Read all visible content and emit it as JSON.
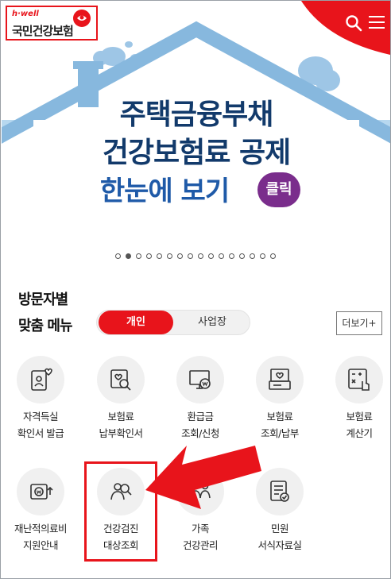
{
  "header": {
    "logo_sub": "h·well",
    "logo_main": "국민건강보험",
    "search_icon": "search-icon",
    "menu_icon": "hamburger-menu-icon"
  },
  "banner": {
    "line1": "주택금융부채",
    "line2": "건강보험료 공제",
    "line3": "한눈에 보기",
    "badge": "클릭",
    "total_slides": 16,
    "active_slide": 2
  },
  "menu": {
    "title_line1": "방문자별",
    "title_line2": "맞춤 메뉴",
    "tab_personal": "개인",
    "tab_business": "사업장",
    "more_button": "더보기+",
    "items": [
      {
        "line1": "자격득실",
        "line2": "확인서 발급",
        "icon": "id-card-heart-icon"
      },
      {
        "line1": "보험료",
        "line2": "납부확인서",
        "icon": "receipt-search-icon"
      },
      {
        "line1": "환급금",
        "line2": "조회/신청",
        "icon": "monitor-refund-icon"
      },
      {
        "line1": "보험료",
        "line2": "조회/납부",
        "icon": "register-bill-icon"
      },
      {
        "line1": "보험료",
        "line2": "계산기",
        "icon": "calculator-icon"
      },
      {
        "line1": "재난적의료비",
        "line2": "지원안내",
        "icon": "support-card-icon"
      },
      {
        "line1": "건강검진",
        "line2": "대상조회",
        "icon": "people-search-icon"
      },
      {
        "line1": "가족",
        "line2": "건강관리",
        "icon": "family-icon"
      },
      {
        "line1": "민원",
        "line2": "서식자료실",
        "icon": "document-check-icon"
      }
    ]
  },
  "colors": {
    "brand_red": "#e8141b",
    "navy": "#123a6b",
    "blue": "#1f5aa8",
    "sky": "#aacfea",
    "badge_purple": "#7a2d8c"
  }
}
